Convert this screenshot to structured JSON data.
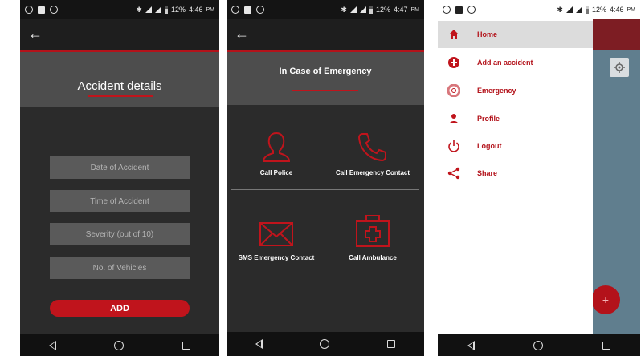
{
  "status": {
    "time1": "4:46",
    "time2": "4:47",
    "time3": "4:46",
    "ampm": "PM",
    "battery": "12%"
  },
  "screen1": {
    "title": "Accident details",
    "fields": [
      {
        "placeholder": "Date of Accident"
      },
      {
        "placeholder": "Time of Accident"
      },
      {
        "placeholder": "Severity (out of 10)"
      },
      {
        "placeholder": "No. of Vehicles"
      }
    ],
    "add_label": "ADD"
  },
  "screen2": {
    "title": "In Case of Emergency",
    "options": [
      {
        "label": "Call Police",
        "icon": "police-icon"
      },
      {
        "label": "Call Emergency Contact",
        "icon": "phone-icon"
      },
      {
        "label": "SMS Emergency Contact",
        "icon": "mail-icon"
      },
      {
        "label": "Call Ambulance",
        "icon": "first-aid-icon"
      }
    ]
  },
  "screen3": {
    "menu": [
      {
        "label": "Home",
        "icon": "home-icon"
      },
      {
        "label": "Add an accident",
        "icon": "plus-circle-icon"
      },
      {
        "label": "Emergency",
        "icon": "lifebuoy-icon"
      },
      {
        "label": "Profile",
        "icon": "person-icon"
      },
      {
        "label": "Logout",
        "icon": "power-icon"
      },
      {
        "label": "Share",
        "icon": "share-icon"
      }
    ],
    "fab_label": "+"
  },
  "colors": {
    "accent": "#b3121a",
    "dark_bg": "#2b2b2b",
    "band": "#4d4d4d"
  }
}
